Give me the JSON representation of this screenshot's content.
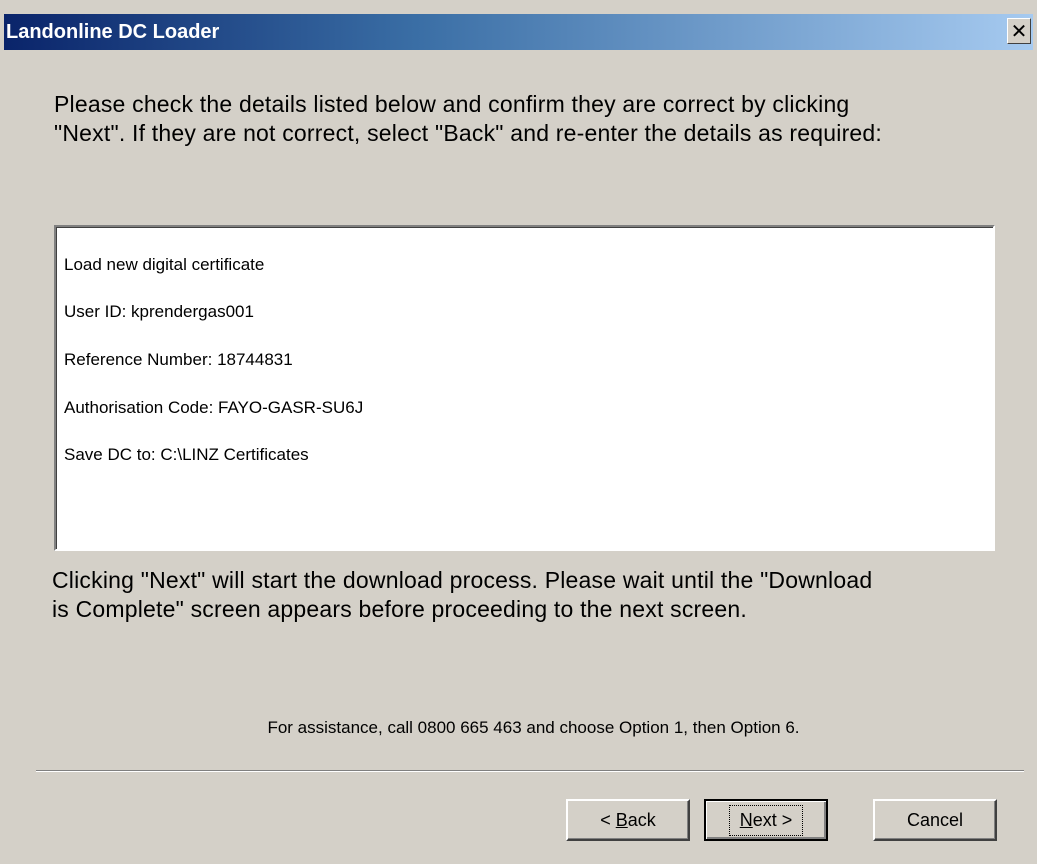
{
  "window": {
    "title": "Landonline DC Loader",
    "close_glyph": "✕"
  },
  "intro": {
    "line1": "Please check the details listed below and confirm they are correct by clicking",
    "line2": "\"Next\".  If they are not correct, select \"Back\" and re-enter the details as required:"
  },
  "details": [
    "Load new digital certificate",
    "User ID: kprendergas001",
    "Reference Number: 18744831",
    "Authorisation Code: FAYO-GASR-SU6J",
    "Save DC to: C:\\LINZ Certificates"
  ],
  "download_note": {
    "line1": "Clicking \"Next\" will start the download process.  Please wait until the \"Download",
    "line2": "is Complete\" screen appears before proceeding to the next screen."
  },
  "assistance": "For assistance, call 0800 665 463 and choose Option 1, then Option 6.",
  "buttons": {
    "back_prefix": "< ",
    "back_mnemonic": "B",
    "back_rest": "ack",
    "next_mnemonic": "N",
    "next_rest": "ext >",
    "cancel": "Cancel"
  },
  "colors": {
    "titlebar_start": "#0a246a",
    "titlebar_end": "#a6caf0",
    "face": "#d4d0c8"
  }
}
